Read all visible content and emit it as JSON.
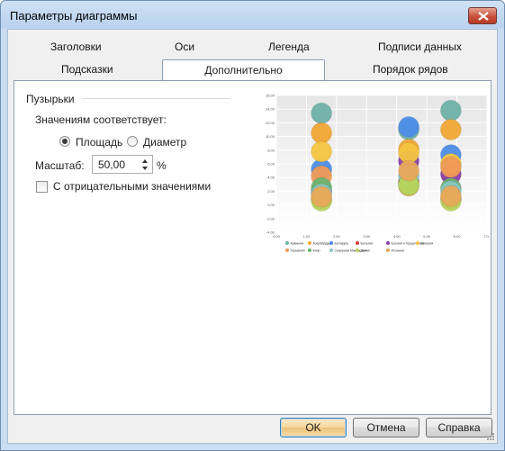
{
  "window": {
    "title": "Параметры диаграммы"
  },
  "tabs": {
    "row1": [
      "Заголовки",
      "Оси",
      "Легенда",
      "Подписи данных"
    ],
    "row2": [
      "Подсказки",
      "Дополнительно",
      "Порядок рядов"
    ],
    "active": "Дополнительно"
  },
  "bubbles": {
    "group_title": "Пузырьки",
    "corresponds_label": "Значениям соответствует:",
    "area_label": "Площадь",
    "diameter_label": "Диаметр",
    "selected": "Площадь",
    "scale_label": "Масштаб:",
    "scale_value": "50,00",
    "scale_unit": "%",
    "negative_label": "С отрицательными значениями",
    "negative_checked": false
  },
  "chart_data": {
    "type": "scatter",
    "style": "bubble",
    "y_ticks": [
      "16,00",
      "14,00",
      "12,00",
      "10,00",
      "8,00",
      "6,00",
      "4,00",
      "2,00",
      "0,00",
      "-2,00",
      "-4,00"
    ],
    "x_ticks": [
      "0,00",
      "1,00",
      "2,00",
      "3,00",
      "4,00",
      "5,00",
      "6,00",
      "7,00"
    ],
    "xlim": [
      0,
      7
    ],
    "ylim": [
      -4,
      16
    ],
    "grid": true,
    "legend_position": "bottom",
    "series": [
      {
        "name": "Армения",
        "color": "#6fb1a8",
        "points": [
          [
            1.5,
            13.4
          ],
          [
            4.4,
            11.0
          ],
          [
            5.8,
            13.8
          ]
        ]
      },
      {
        "name": "Азербайджан",
        "color": "#f1a734",
        "points": [
          [
            1.5,
            10.5
          ],
          [
            4.4,
            8.1
          ],
          [
            5.8,
            11.0
          ]
        ]
      },
      {
        "name": "Беларусь",
        "color": "#4d8ee6",
        "points": [
          [
            1.5,
            5.2
          ],
          [
            4.4,
            11.4
          ],
          [
            5.8,
            7.3
          ]
        ]
      },
      {
        "name": "Бельгия",
        "color": "#d63b32",
        "points": [
          [
            1.5,
            0.9
          ],
          [
            4.4,
            3.4
          ],
          [
            5.8,
            0.9
          ]
        ]
      },
      {
        "name": "Босния и Герцеговина",
        "color": "#8a3fa8",
        "points": [
          [
            1.5,
            2.0
          ],
          [
            4.4,
            6.4
          ],
          [
            5.8,
            4.5
          ]
        ]
      },
      {
        "name": "Венгрия",
        "color": "#f5c542",
        "points": [
          [
            1.5,
            7.8
          ],
          [
            4.4,
            7.6
          ],
          [
            5.8,
            6.0
          ]
        ]
      },
      {
        "name": "Германия",
        "color": "#ef9a57",
        "points": [
          [
            1.5,
            4.2
          ],
          [
            4.4,
            2.8
          ],
          [
            5.8,
            5.5
          ]
        ]
      },
      {
        "name": "Кипр",
        "color": "#6bb56f",
        "points": [
          [
            1.5,
            2.5
          ],
          [
            4.4,
            3.0
          ],
          [
            5.8,
            2.4
          ]
        ]
      },
      {
        "name": "Северная Македония",
        "color": "#89c6c2",
        "points": [
          [
            1.5,
            1.6
          ],
          [
            4.4,
            4.2
          ],
          [
            5.8,
            2.0
          ]
        ]
      },
      {
        "name": "Дания",
        "color": "#b8d45c",
        "points": [
          [
            1.5,
            0.6
          ],
          [
            4.4,
            2.9
          ],
          [
            5.8,
            0.6
          ]
        ]
      },
      {
        "name": "Испания",
        "color": "#e8a95a",
        "points": [
          [
            1.5,
            1.2
          ],
          [
            4.4,
            5.0
          ],
          [
            5.8,
            1.3
          ]
        ]
      }
    ]
  },
  "buttons": {
    "ok": "OK",
    "cancel": "Отмена",
    "help": "Справка"
  }
}
